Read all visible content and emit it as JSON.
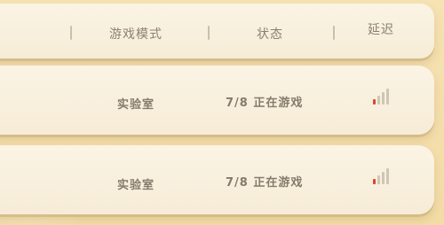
{
  "header": {
    "col_mode": "游戏模式",
    "col_status": "状态",
    "col_latency": "延迟"
  },
  "rooms": [
    {
      "mode": "实验室",
      "status": "7/8 正在游戏",
      "signal_level": 1,
      "signal_max": 4
    },
    {
      "mode": "实验室",
      "status": "7/8 正在游戏",
      "signal_level": 1,
      "signal_max": 4
    }
  ],
  "colors": {
    "background": "#f4dfae",
    "panel": "#fbf4e4",
    "text": "#8b8170",
    "signal_active": "#d64a31",
    "signal_inactive": "#cfc6b5"
  }
}
